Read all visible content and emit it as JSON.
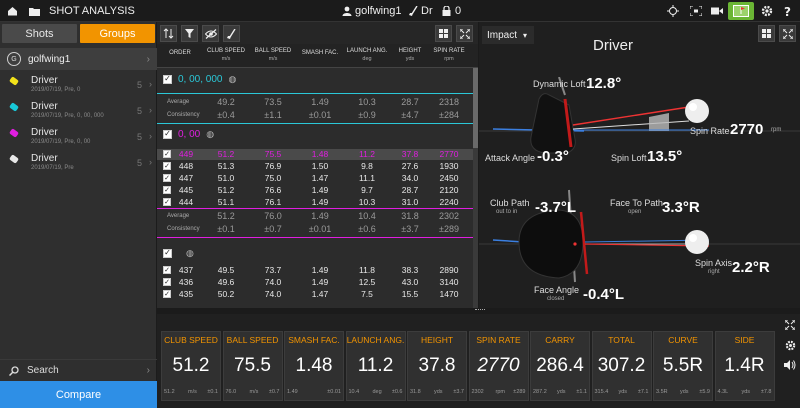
{
  "topbar": {
    "title": "SHOT ANALYSIS",
    "user": "golfwing1",
    "club": "Dr",
    "lock_count": "0"
  },
  "sidebar": {
    "tabs": {
      "shots": "Shots",
      "groups": "Groups"
    },
    "user": {
      "initial": "G",
      "name": "golfwing1"
    },
    "groups": [
      {
        "name": "Driver",
        "sub": "2019/07/19, Pre, 0",
        "count": "5",
        "color": "#f2e21a"
      },
      {
        "name": "Driver",
        "sub": "2019/07/19, Pre, 0, 00, 000",
        "count": "5",
        "color": "#18c8d8"
      },
      {
        "name": "Driver",
        "sub": "2019/07/19, Pre, 0, 00",
        "count": "5",
        "color": "#e01ee0"
      },
      {
        "name": "Driver",
        "sub": "2019/07/19, Pre",
        "count": "5",
        "color": "#e8e8e8"
      }
    ],
    "search": "Search",
    "compare": "Compare"
  },
  "table": {
    "columns": [
      {
        "name": "ORDER",
        "unit": ""
      },
      {
        "name": "CLUB SPEED",
        "unit": "m/s"
      },
      {
        "name": "BALL SPEED",
        "unit": "m/s"
      },
      {
        "name": "SMASH FAC.",
        "unit": ""
      },
      {
        "name": "LAUNCH ANG.",
        "unit": "deg"
      },
      {
        "name": "HEIGHT",
        "unit": "yds"
      },
      {
        "name": "SPIN RATE",
        "unit": "rpm"
      }
    ],
    "group1": {
      "name": "0, 00, 000",
      "color": "#2bc8d8",
      "average_label": "Average",
      "consistency_label": "Consistency",
      "average": [
        "49.2",
        "73.5",
        "1.49",
        "10.3",
        "28.7",
        "2318"
      ],
      "consistency": [
        "±0.4",
        "±1.1",
        "±0.01",
        "±0.9",
        "±4.7",
        "±284"
      ]
    },
    "group2": {
      "name": "0, 00",
      "color": "#e01ee0",
      "rows": [
        [
          "449",
          "51.2",
          "75.5",
          "1.48",
          "11.2",
          "37.8",
          "2770"
        ],
        [
          "448",
          "51.3",
          "76.9",
          "1.50",
          "9.8",
          "27.6",
          "1930"
        ],
        [
          "447",
          "51.0",
          "75.0",
          "1.47",
          "11.1",
          "34.0",
          "2450"
        ],
        [
          "445",
          "51.2",
          "76.6",
          "1.49",
          "9.7",
          "28.7",
          "2120"
        ],
        [
          "444",
          "51.1",
          "76.1",
          "1.49",
          "10.3",
          "31.0",
          "2240"
        ]
      ],
      "average_label": "Average",
      "consistency_label": "Consistency",
      "average": [
        "51.2",
        "76.0",
        "1.49",
        "10.4",
        "31.8",
        "2302"
      ],
      "consistency": [
        "±0.1",
        "±0.7",
        "±0.01",
        "±0.6",
        "±3.7",
        "±289"
      ]
    },
    "group3": {
      "rows": [
        [
          "437",
          "49.5",
          "73.7",
          "1.49",
          "11.8",
          "38.3",
          "2890"
        ],
        [
          "436",
          "49.6",
          "74.0",
          "1.49",
          "12.5",
          "43.0",
          "3140"
        ],
        [
          "435",
          "50.2",
          "74.0",
          "1.47",
          "7.5",
          "15.5",
          "1470"
        ]
      ]
    }
  },
  "impact": {
    "selector": "Impact",
    "title": "Driver",
    "dynamic_loft_label": "Dynamic Loft",
    "dynamic_loft": "12.8°",
    "spin_rate_label": "Spin Rate",
    "spin_rate": "2770",
    "spin_rate_unit": "rpm",
    "attack_angle_label": "Attack Angle",
    "attack_angle": "-0.3°",
    "spin_loft_label": "Spin Loft",
    "spin_loft": "13.5°",
    "club_path_label": "Club Path",
    "club_path_sub": "out to in",
    "club_path": "-3.7°L",
    "face_to_path_label": "Face To Path",
    "face_to_path_sub": "open",
    "face_to_path": "3.3°R",
    "spin_axis_label": "Spin Axis",
    "spin_axis_sub": "right",
    "spin_axis": "2.2°R",
    "face_angle_label": "Face Angle",
    "face_angle_sub": "closed",
    "face_angle": "-0.4°L"
  },
  "metrics": [
    {
      "label": "CLUB SPEED",
      "value": "51.2",
      "left": "51.2",
      "unit": "m/s",
      "right": "±0.1"
    },
    {
      "label": "BALL SPEED",
      "value": "75.5",
      "left": "76.0",
      "unit": "m/s",
      "right": "±0.7"
    },
    {
      "label": "SMASH FAC.",
      "value": "1.48",
      "left": "1.49",
      "unit": "",
      "right": "±0.01"
    },
    {
      "label": "LAUNCH ANG.",
      "value": "11.2",
      "left": "10.4",
      "unit": "deg",
      "right": "±0.6"
    },
    {
      "label": "HEIGHT",
      "value": "37.8",
      "left": "31.8",
      "unit": "yds",
      "right": "±3.7"
    },
    {
      "label": "SPIN RATE",
      "value": "2770",
      "left": "2302",
      "unit": "rpm",
      "right": "±289"
    },
    {
      "label": "CARRY",
      "value": "286.4",
      "left": "287.2",
      "unit": "yds",
      "right": "±1.1"
    },
    {
      "label": "TOTAL",
      "value": "307.2",
      "left": "315.4",
      "unit": "yds",
      "right": "±7.1"
    },
    {
      "label": "CURVE",
      "value": "5.5R",
      "left": "3.5R",
      "unit": "yds",
      "right": "±5.9"
    },
    {
      "label": "SIDE",
      "value": "1.4R",
      "left": "4.3L",
      "unit": "yds",
      "right": "±7.8"
    }
  ]
}
